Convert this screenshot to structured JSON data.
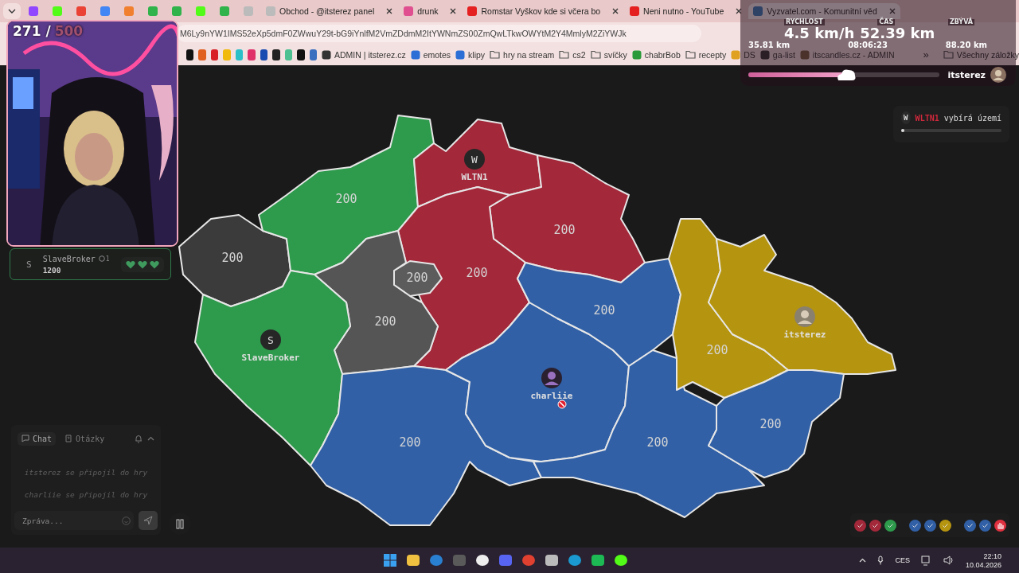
{
  "browser": {
    "tabs": [
      {
        "title": "Obchod - @itsterez panel",
        "selected": false
      },
      {
        "title": "drunk",
        "selected": false
      },
      {
        "title": "Romstar Vyškov kde si včera bo",
        "selected": false
      },
      {
        "title": "Neni nutno - YouTube",
        "selected": false
      },
      {
        "title": "Vyzvatel.com - Komunitní věd",
        "selected": true
      }
    ],
    "address": "M6Ly9nYW1IMS52eXp5dmF0ZWwuY29t-bG9iYnlfM2VmZDdmM2ItYWNmZS00ZmQwLTkwOWYtM2Y4MmlyM2ZiYWJk",
    "bookmarks": [
      {
        "kind": "site",
        "label": "ADMIN | itsterez.cz"
      },
      {
        "kind": "site",
        "label": "emotes"
      },
      {
        "kind": "site",
        "label": "klipy"
      },
      {
        "kind": "folder",
        "label": "hry na stream"
      },
      {
        "kind": "folder",
        "label": "cs2"
      },
      {
        "kind": "folder",
        "label": "svíčky"
      },
      {
        "kind": "site",
        "label": "chabrBob"
      },
      {
        "kind": "folder",
        "label": "recepty"
      },
      {
        "kind": "site",
        "label": "DS"
      },
      {
        "kind": "site",
        "label": "ga-list"
      },
      {
        "kind": "site",
        "label": "itscandles.cz - ADMIN"
      }
    ],
    "more": "»",
    "all_bookmarks": "Všechny záložky"
  },
  "webcam": {
    "count": "271 /",
    "goal": "500"
  },
  "trip": {
    "speed_label": "RYCHLOST",
    "speed": "4.5 km/h",
    "distance": "52.39 km",
    "remaining_label": "ZBÝVÁ",
    "walked": "35.81 km",
    "remaining": "88.20 km",
    "time_label": "ČAS",
    "time": "08:06:23",
    "level": 0.5,
    "streamer": "itsterez"
  },
  "player_card": {
    "initial": "S",
    "name": "SlaveBroker",
    "badge": "1",
    "score": "1200",
    "hearts": [
      {
        "filled": true
      },
      {
        "filled": true
      },
      {
        "filled": true
      }
    ]
  },
  "map": {
    "regions": [
      {
        "color": "#3b3b3b",
        "label": "200"
      },
      {
        "color": "#2e9a4c",
        "label": "200"
      },
      {
        "color": "#a3283a",
        "marker": {
          "kind": "letter",
          "letter": "W",
          "name": "WLTN1",
          "blocked": false
        }
      },
      {
        "color": "#a3283a",
        "label": "200"
      },
      {
        "color": "#a3283a",
        "label": "200"
      },
      {
        "color": "#5c5c5c",
        "label": "200"
      },
      {
        "color": "#555555",
        "label": "200"
      },
      {
        "color": "#2e9a4c",
        "marker": {
          "kind": "letter",
          "letter": "S",
          "name": "SlaveBroker",
          "blocked": false
        }
      },
      {
        "color": "#3160a6",
        "label": "200"
      },
      {
        "color": "#3160a6",
        "marker": {
          "kind": "avatar",
          "name": "charliie",
          "blocked": true
        }
      },
      {
        "color": "#3160a6",
        "label": "200"
      },
      {
        "color": "#3160a6",
        "label": "200"
      },
      {
        "color": "#b5940f",
        "label": "200"
      },
      {
        "color": "#b5940f",
        "marker": {
          "kind": "avatar",
          "name": "itsterez",
          "blocked": false
        }
      },
      {
        "color": "#3160a6",
        "label": "200"
      }
    ]
  },
  "toast": {
    "initial": "W",
    "player": "WLTN1",
    "text": "vybírá území",
    "level": 0.03
  },
  "chat": {
    "tabs": [
      {
        "label": "Chat",
        "selected": true
      },
      {
        "label": "Otázky",
        "selected": false
      }
    ],
    "messages": [
      "itsterez se připojil do hry",
      "charliie se připojil do hry"
    ],
    "placeholder": "Zpráva..."
  },
  "votes": [
    {
      "kind": "check",
      "color": "#a3283a"
    },
    {
      "kind": "check",
      "color": "#a3283a"
    },
    {
      "kind": "check",
      "color": "#2e9a4c"
    },
    {
      "kind": "check",
      "color": "#3160a6"
    },
    {
      "kind": "check",
      "color": "#3160a6"
    },
    {
      "kind": "check",
      "color": "#b5940f"
    },
    {
      "kind": "check",
      "color": "#3160a6"
    },
    {
      "kind": "check",
      "color": "#3160a6"
    },
    {
      "kind": "hand",
      "color": "#e0303f"
    }
  ],
  "taskbar": {
    "language": "CES",
    "time": "22:10",
    "date": "10.04.2026"
  }
}
